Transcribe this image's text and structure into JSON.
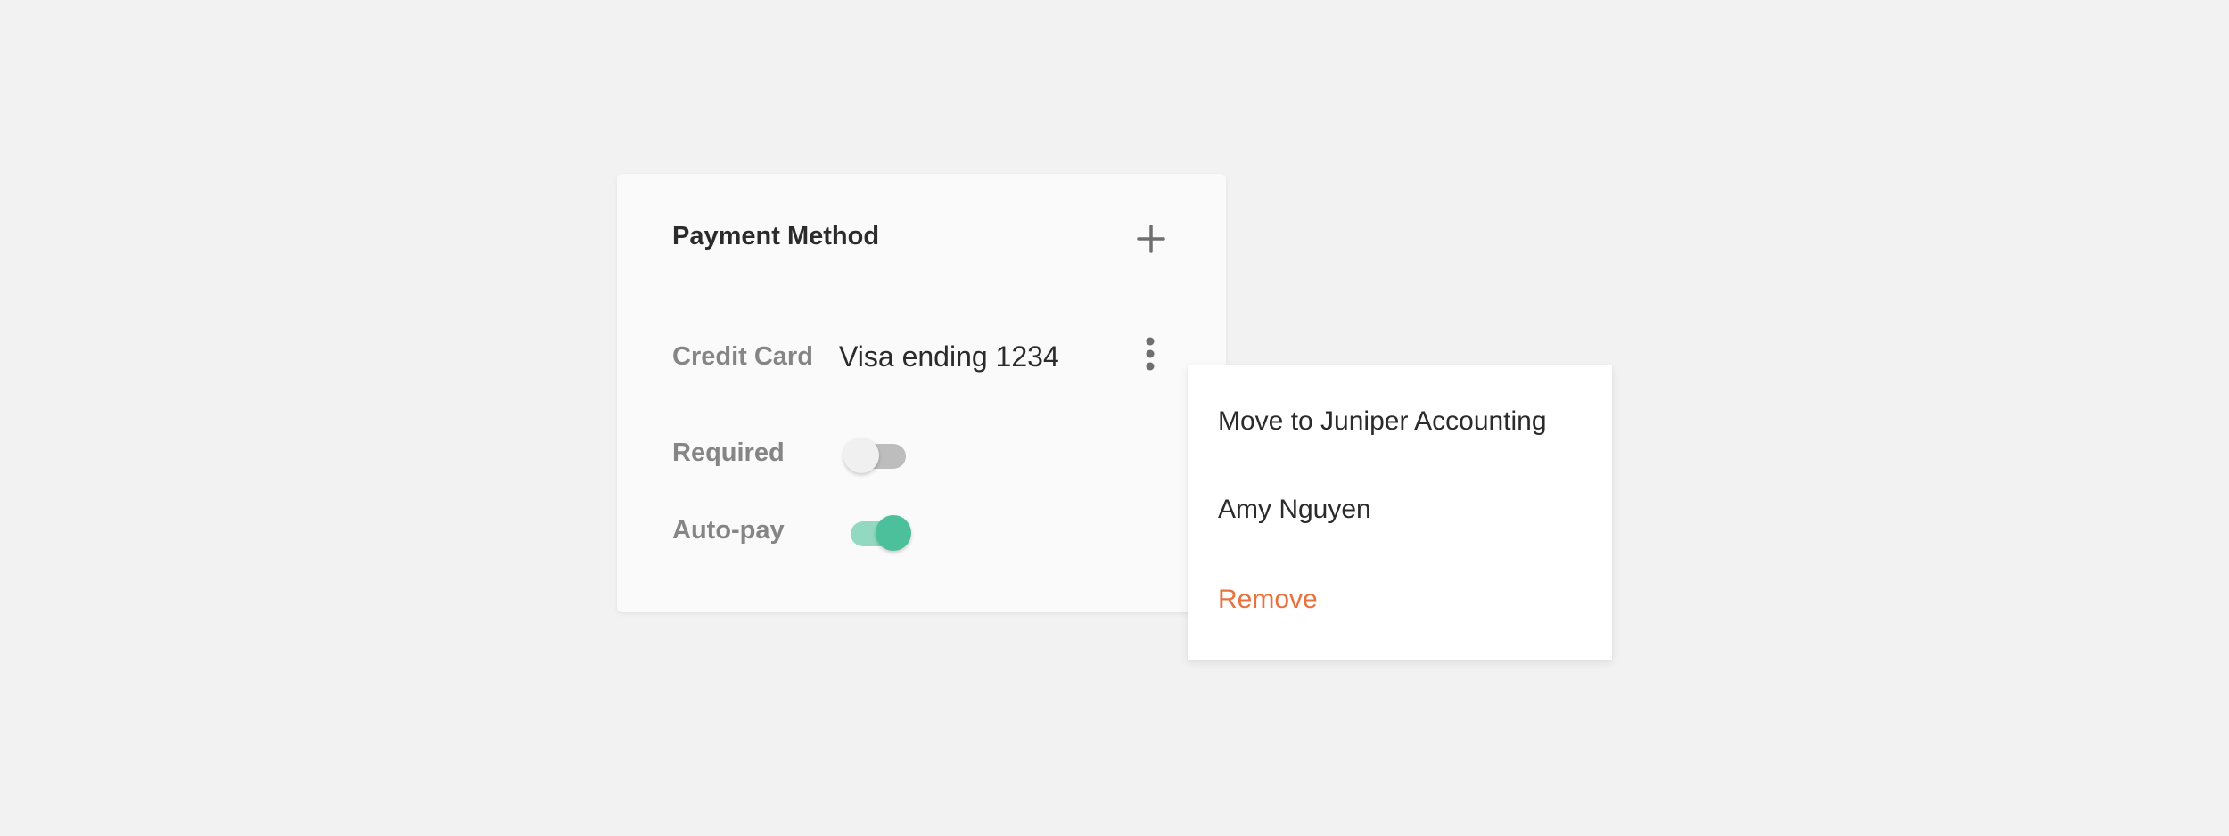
{
  "card": {
    "title": "Payment Method",
    "add_icon": "plus-icon",
    "payment": {
      "label": "Credit Card",
      "value": "Visa ending 1234",
      "menu_icon": "more-vertical-icon"
    },
    "toggles": [
      {
        "label": "Required",
        "enabled": false
      },
      {
        "label": "Auto-pay",
        "enabled": true
      }
    ]
  },
  "menu": {
    "items": [
      {
        "label": "Move to Juniper Accounting"
      },
      {
        "label": "Amy Nguyen"
      },
      {
        "label": "Remove",
        "color": "#e8713e"
      }
    ]
  },
  "colors": {
    "background": "#f2f2f2",
    "card": "#fafafa",
    "accent_green": "#4cc09a",
    "danger_orange": "#e8713e"
  }
}
